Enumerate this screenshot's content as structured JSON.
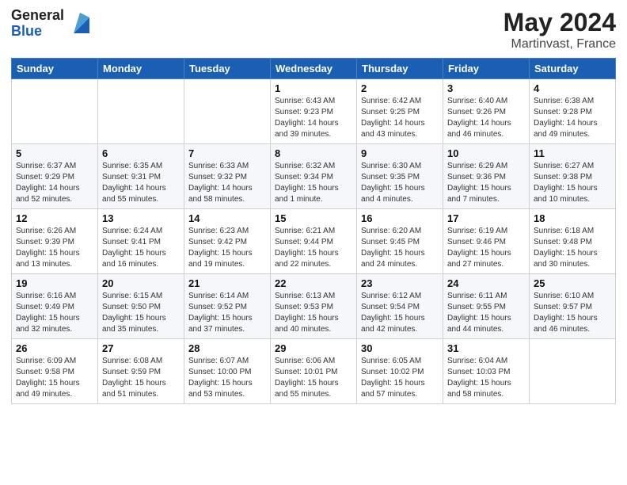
{
  "logo": {
    "general": "General",
    "blue": "Blue"
  },
  "title": {
    "month_year": "May 2024",
    "location": "Martinvast, France"
  },
  "days_of_week": [
    "Sunday",
    "Monday",
    "Tuesday",
    "Wednesday",
    "Thursday",
    "Friday",
    "Saturday"
  ],
  "weeks": [
    [
      {
        "day": "",
        "info": ""
      },
      {
        "day": "",
        "info": ""
      },
      {
        "day": "",
        "info": ""
      },
      {
        "day": "1",
        "info": "Sunrise: 6:43 AM\nSunset: 9:23 PM\nDaylight: 14 hours\nand 39 minutes."
      },
      {
        "day": "2",
        "info": "Sunrise: 6:42 AM\nSunset: 9:25 PM\nDaylight: 14 hours\nand 43 minutes."
      },
      {
        "day": "3",
        "info": "Sunrise: 6:40 AM\nSunset: 9:26 PM\nDaylight: 14 hours\nand 46 minutes."
      },
      {
        "day": "4",
        "info": "Sunrise: 6:38 AM\nSunset: 9:28 PM\nDaylight: 14 hours\nand 49 minutes."
      }
    ],
    [
      {
        "day": "5",
        "info": "Sunrise: 6:37 AM\nSunset: 9:29 PM\nDaylight: 14 hours\nand 52 minutes."
      },
      {
        "day": "6",
        "info": "Sunrise: 6:35 AM\nSunset: 9:31 PM\nDaylight: 14 hours\nand 55 minutes."
      },
      {
        "day": "7",
        "info": "Sunrise: 6:33 AM\nSunset: 9:32 PM\nDaylight: 14 hours\nand 58 minutes."
      },
      {
        "day": "8",
        "info": "Sunrise: 6:32 AM\nSunset: 9:34 PM\nDaylight: 15 hours\nand 1 minute."
      },
      {
        "day": "9",
        "info": "Sunrise: 6:30 AM\nSunset: 9:35 PM\nDaylight: 15 hours\nand 4 minutes."
      },
      {
        "day": "10",
        "info": "Sunrise: 6:29 AM\nSunset: 9:36 PM\nDaylight: 15 hours\nand 7 minutes."
      },
      {
        "day": "11",
        "info": "Sunrise: 6:27 AM\nSunset: 9:38 PM\nDaylight: 15 hours\nand 10 minutes."
      }
    ],
    [
      {
        "day": "12",
        "info": "Sunrise: 6:26 AM\nSunset: 9:39 PM\nDaylight: 15 hours\nand 13 minutes."
      },
      {
        "day": "13",
        "info": "Sunrise: 6:24 AM\nSunset: 9:41 PM\nDaylight: 15 hours\nand 16 minutes."
      },
      {
        "day": "14",
        "info": "Sunrise: 6:23 AM\nSunset: 9:42 PM\nDaylight: 15 hours\nand 19 minutes."
      },
      {
        "day": "15",
        "info": "Sunrise: 6:21 AM\nSunset: 9:44 PM\nDaylight: 15 hours\nand 22 minutes."
      },
      {
        "day": "16",
        "info": "Sunrise: 6:20 AM\nSunset: 9:45 PM\nDaylight: 15 hours\nand 24 minutes."
      },
      {
        "day": "17",
        "info": "Sunrise: 6:19 AM\nSunset: 9:46 PM\nDaylight: 15 hours\nand 27 minutes."
      },
      {
        "day": "18",
        "info": "Sunrise: 6:18 AM\nSunset: 9:48 PM\nDaylight: 15 hours\nand 30 minutes."
      }
    ],
    [
      {
        "day": "19",
        "info": "Sunrise: 6:16 AM\nSunset: 9:49 PM\nDaylight: 15 hours\nand 32 minutes."
      },
      {
        "day": "20",
        "info": "Sunrise: 6:15 AM\nSunset: 9:50 PM\nDaylight: 15 hours\nand 35 minutes."
      },
      {
        "day": "21",
        "info": "Sunrise: 6:14 AM\nSunset: 9:52 PM\nDaylight: 15 hours\nand 37 minutes."
      },
      {
        "day": "22",
        "info": "Sunrise: 6:13 AM\nSunset: 9:53 PM\nDaylight: 15 hours\nand 40 minutes."
      },
      {
        "day": "23",
        "info": "Sunrise: 6:12 AM\nSunset: 9:54 PM\nDaylight: 15 hours\nand 42 minutes."
      },
      {
        "day": "24",
        "info": "Sunrise: 6:11 AM\nSunset: 9:55 PM\nDaylight: 15 hours\nand 44 minutes."
      },
      {
        "day": "25",
        "info": "Sunrise: 6:10 AM\nSunset: 9:57 PM\nDaylight: 15 hours\nand 46 minutes."
      }
    ],
    [
      {
        "day": "26",
        "info": "Sunrise: 6:09 AM\nSunset: 9:58 PM\nDaylight: 15 hours\nand 49 minutes."
      },
      {
        "day": "27",
        "info": "Sunrise: 6:08 AM\nSunset: 9:59 PM\nDaylight: 15 hours\nand 51 minutes."
      },
      {
        "day": "28",
        "info": "Sunrise: 6:07 AM\nSunset: 10:00 PM\nDaylight: 15 hours\nand 53 minutes."
      },
      {
        "day": "29",
        "info": "Sunrise: 6:06 AM\nSunset: 10:01 PM\nDaylight: 15 hours\nand 55 minutes."
      },
      {
        "day": "30",
        "info": "Sunrise: 6:05 AM\nSunset: 10:02 PM\nDaylight: 15 hours\nand 57 minutes."
      },
      {
        "day": "31",
        "info": "Sunrise: 6:04 AM\nSunset: 10:03 PM\nDaylight: 15 hours\nand 58 minutes."
      },
      {
        "day": "",
        "info": ""
      }
    ]
  ]
}
